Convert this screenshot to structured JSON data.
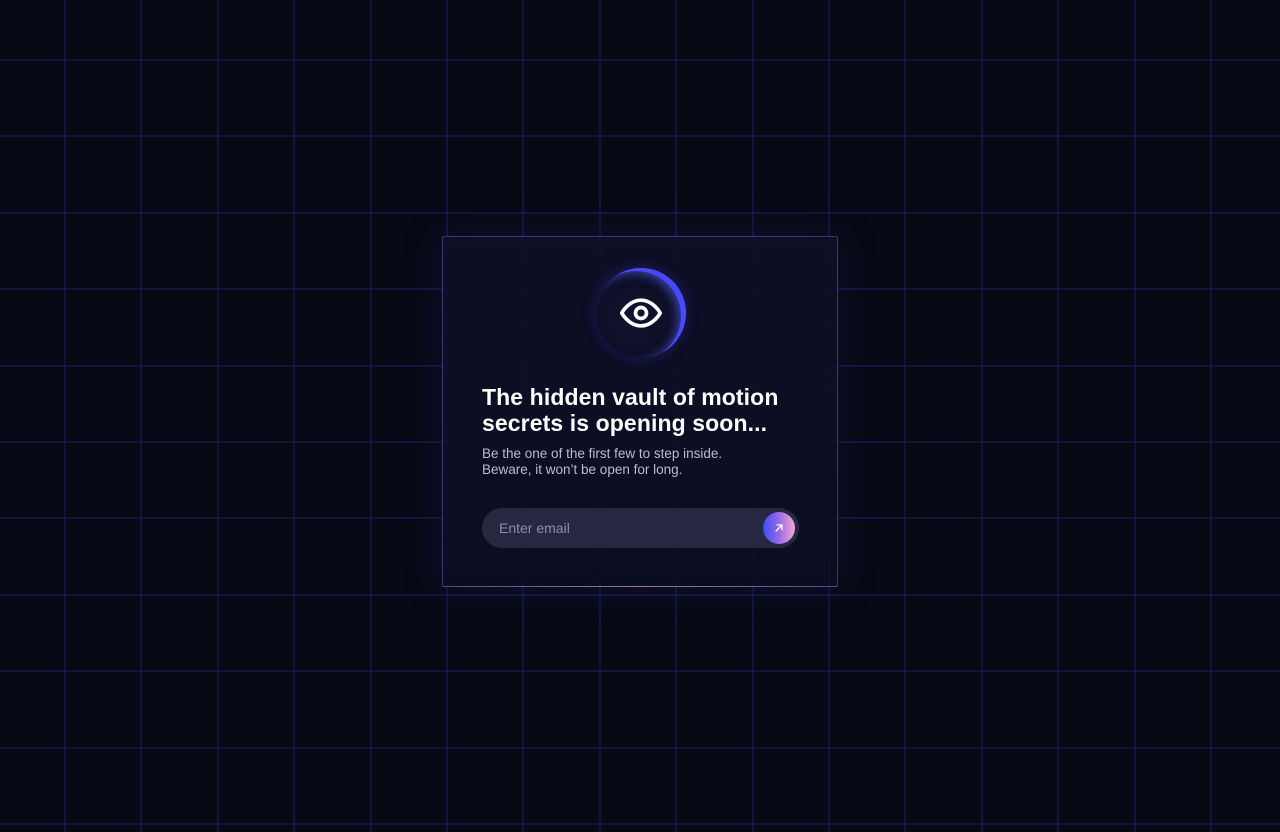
{
  "page": {
    "background_color": "#070a14",
    "grid_color": "#1e2070",
    "highlight_color": "#c8c8e6"
  },
  "card": {
    "icon": "eye-icon",
    "title": "The hidden vault of motion secrets is opening soon...",
    "subtitle_line1": "Be the one of the first few to step inside.",
    "subtitle_line2": "Beware, it won’t be open for long.",
    "accent_color": "#4a48ff"
  },
  "signup": {
    "email_value": "",
    "email_placeholder": "Enter email",
    "submit_icon": "arrow-up-right-icon",
    "button_gradient": [
      "#3a4cf0",
      "#9a6be8",
      "#f2a6cf"
    ]
  }
}
